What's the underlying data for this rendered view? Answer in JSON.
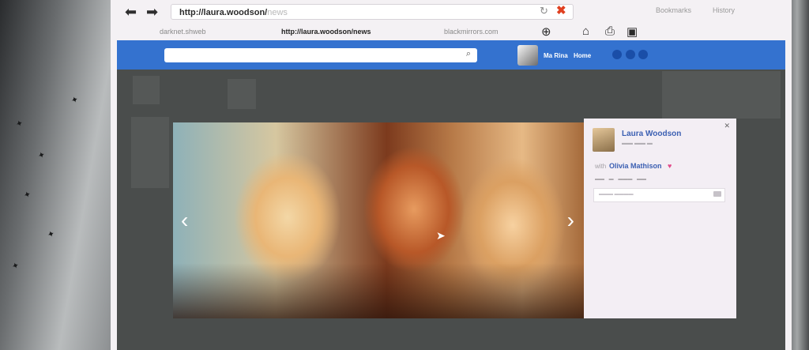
{
  "browser": {
    "address_main": "http://laura.woodson/",
    "address_tail": "news",
    "bookmarks_label": "Bookmarks",
    "history_label": "History",
    "tabs": [
      {
        "label": "darknet.shweb"
      },
      {
        "label": "http://laura.woodson/news"
      },
      {
        "label": "blackmirrors.com"
      }
    ]
  },
  "header": {
    "user_name": "Ma Rina",
    "home_label": "Home"
  },
  "post": {
    "author": "Laura Woodson",
    "with_label": "with",
    "tagged_friend": "Olivia Mathison"
  },
  "colors": {
    "header_blue": "#3472cf",
    "link_blue": "#3b5fb2",
    "close_red": "#e04020"
  }
}
